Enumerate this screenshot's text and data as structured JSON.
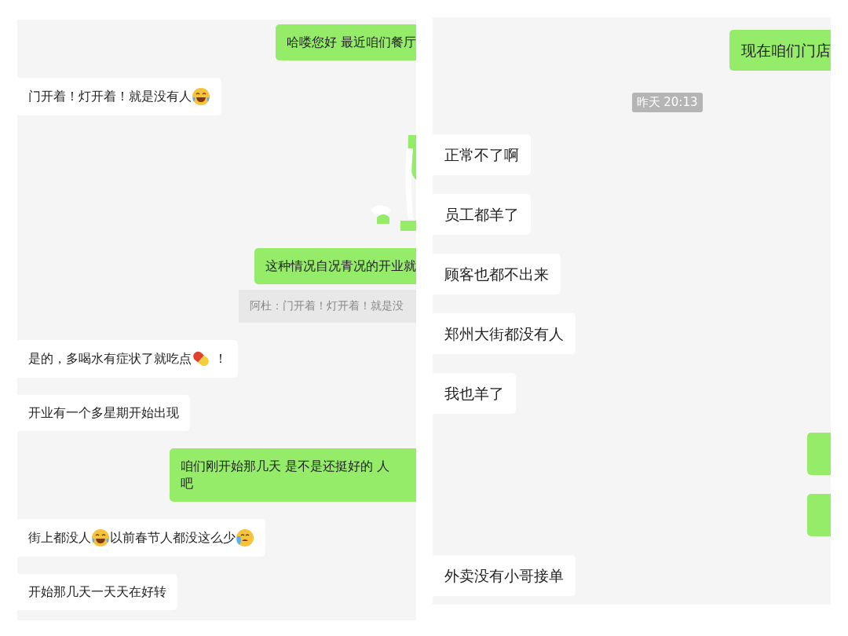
{
  "panels": [
    {
      "messages": [
        {
          "kind": "outgoing",
          "parts": [
            {
              "kind": "text",
              "text": "哈喽您好 最近咱们餐厅"
            }
          ]
        },
        {
          "kind": "incoming",
          "parts": [
            {
              "kind": "text",
              "text": "门开着！灯开着！就是没有人"
            },
            {
              "kind": "laugh"
            }
          ]
        },
        {
          "kind": "erased"
        },
        {
          "kind": "outgoing",
          "parts": [
            {
              "kind": "text",
              "text": "这种情况自况青况的开业就"
            }
          ],
          "quote": "阿杜：门开着！灯开着！就是没"
        },
        {
          "kind": "incoming",
          "parts": [
            {
              "kind": "text",
              "text": "是的，多喝水有症状了就吃点"
            },
            {
              "kind": "pill"
            },
            {
              "kind": "text",
              "text": " ！"
            }
          ]
        },
        {
          "kind": "incoming",
          "parts": [
            {
              "kind": "text",
              "text": "开业有一个多星期开始出现"
            }
          ]
        },
        {
          "kind": "outgoing",
          "parts": [
            {
              "kind": "line",
              "text": "咱们刚开始那几天 是不是还挺好的 人"
            },
            {
              "kind": "line",
              "text": "吧"
            }
          ]
        },
        {
          "kind": "incoming",
          "parts": [
            {
              "kind": "text",
              "text": "街上都没人"
            },
            {
              "kind": "laugh"
            },
            {
              "kind": "text",
              "text": "以前春节人都没这么少"
            },
            {
              "kind": "cry"
            }
          ]
        },
        {
          "kind": "incoming",
          "parts": [
            {
              "kind": "text",
              "text": "开始那几天一天天在好转"
            }
          ]
        }
      ]
    },
    {
      "messages": [
        {
          "kind": "outgoing",
          "parts": [
            {
              "kind": "text",
              "text": "现在咱们门店"
            }
          ]
        },
        {
          "kind": "time",
          "text": "昨天 20:13"
        },
        {
          "kind": "incoming",
          "parts": [
            {
              "kind": "text",
              "text": "正常不了啊"
            }
          ]
        },
        {
          "kind": "incoming",
          "parts": [
            {
              "kind": "text",
              "text": "员工都羊了"
            }
          ]
        },
        {
          "kind": "incoming",
          "parts": [
            {
              "kind": "text",
              "text": "顾客也都不出来"
            }
          ]
        },
        {
          "kind": "incoming",
          "parts": [
            {
              "kind": "text",
              "text": "郑州大街都没有人"
            }
          ]
        },
        {
          "kind": "incoming",
          "parts": [
            {
              "kind": "text",
              "text": "我也羊了"
            }
          ]
        },
        {
          "kind": "sliver"
        },
        {
          "kind": "sliver"
        },
        {
          "kind": "incoming",
          "parts": [
            {
              "kind": "text",
              "text": "外卖没有小哥接单"
            }
          ]
        }
      ]
    }
  ]
}
